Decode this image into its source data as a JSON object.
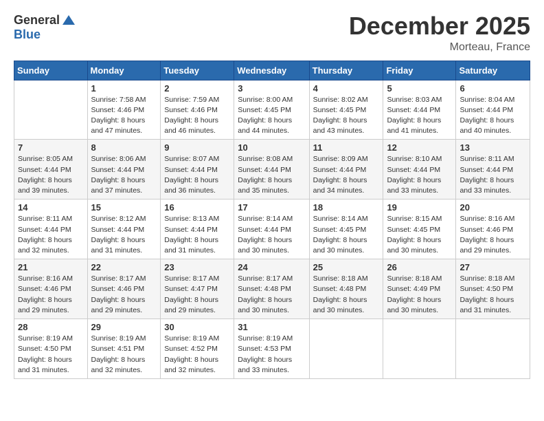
{
  "logo": {
    "general": "General",
    "blue": "Blue"
  },
  "title": {
    "month": "December 2025",
    "location": "Morteau, France"
  },
  "headers": [
    "Sunday",
    "Monday",
    "Tuesday",
    "Wednesday",
    "Thursday",
    "Friday",
    "Saturday"
  ],
  "weeks": [
    [
      {
        "day": "",
        "sunrise": "",
        "sunset": "",
        "daylight": ""
      },
      {
        "day": "1",
        "sunrise": "Sunrise: 7:58 AM",
        "sunset": "Sunset: 4:46 PM",
        "daylight": "Daylight: 8 hours and 47 minutes."
      },
      {
        "day": "2",
        "sunrise": "Sunrise: 7:59 AM",
        "sunset": "Sunset: 4:46 PM",
        "daylight": "Daylight: 8 hours and 46 minutes."
      },
      {
        "day": "3",
        "sunrise": "Sunrise: 8:00 AM",
        "sunset": "Sunset: 4:45 PM",
        "daylight": "Daylight: 8 hours and 44 minutes."
      },
      {
        "day": "4",
        "sunrise": "Sunrise: 8:02 AM",
        "sunset": "Sunset: 4:45 PM",
        "daylight": "Daylight: 8 hours and 43 minutes."
      },
      {
        "day": "5",
        "sunrise": "Sunrise: 8:03 AM",
        "sunset": "Sunset: 4:44 PM",
        "daylight": "Daylight: 8 hours and 41 minutes."
      },
      {
        "day": "6",
        "sunrise": "Sunrise: 8:04 AM",
        "sunset": "Sunset: 4:44 PM",
        "daylight": "Daylight: 8 hours and 40 minutes."
      }
    ],
    [
      {
        "day": "7",
        "sunrise": "Sunrise: 8:05 AM",
        "sunset": "Sunset: 4:44 PM",
        "daylight": "Daylight: 8 hours and 39 minutes."
      },
      {
        "day": "8",
        "sunrise": "Sunrise: 8:06 AM",
        "sunset": "Sunset: 4:44 PM",
        "daylight": "Daylight: 8 hours and 37 minutes."
      },
      {
        "day": "9",
        "sunrise": "Sunrise: 8:07 AM",
        "sunset": "Sunset: 4:44 PM",
        "daylight": "Daylight: 8 hours and 36 minutes."
      },
      {
        "day": "10",
        "sunrise": "Sunrise: 8:08 AM",
        "sunset": "Sunset: 4:44 PM",
        "daylight": "Daylight: 8 hours and 35 minutes."
      },
      {
        "day": "11",
        "sunrise": "Sunrise: 8:09 AM",
        "sunset": "Sunset: 4:44 PM",
        "daylight": "Daylight: 8 hours and 34 minutes."
      },
      {
        "day": "12",
        "sunrise": "Sunrise: 8:10 AM",
        "sunset": "Sunset: 4:44 PM",
        "daylight": "Daylight: 8 hours and 33 minutes."
      },
      {
        "day": "13",
        "sunrise": "Sunrise: 8:11 AM",
        "sunset": "Sunset: 4:44 PM",
        "daylight": "Daylight: 8 hours and 33 minutes."
      }
    ],
    [
      {
        "day": "14",
        "sunrise": "Sunrise: 8:11 AM",
        "sunset": "Sunset: 4:44 PM",
        "daylight": "Daylight: 8 hours and 32 minutes."
      },
      {
        "day": "15",
        "sunrise": "Sunrise: 8:12 AM",
        "sunset": "Sunset: 4:44 PM",
        "daylight": "Daylight: 8 hours and 31 minutes."
      },
      {
        "day": "16",
        "sunrise": "Sunrise: 8:13 AM",
        "sunset": "Sunset: 4:44 PM",
        "daylight": "Daylight: 8 hours and 31 minutes."
      },
      {
        "day": "17",
        "sunrise": "Sunrise: 8:14 AM",
        "sunset": "Sunset: 4:44 PM",
        "daylight": "Daylight: 8 hours and 30 minutes."
      },
      {
        "day": "18",
        "sunrise": "Sunrise: 8:14 AM",
        "sunset": "Sunset: 4:45 PM",
        "daylight": "Daylight: 8 hours and 30 minutes."
      },
      {
        "day": "19",
        "sunrise": "Sunrise: 8:15 AM",
        "sunset": "Sunset: 4:45 PM",
        "daylight": "Daylight: 8 hours and 30 minutes."
      },
      {
        "day": "20",
        "sunrise": "Sunrise: 8:16 AM",
        "sunset": "Sunset: 4:46 PM",
        "daylight": "Daylight: 8 hours and 29 minutes."
      }
    ],
    [
      {
        "day": "21",
        "sunrise": "Sunrise: 8:16 AM",
        "sunset": "Sunset: 4:46 PM",
        "daylight": "Daylight: 8 hours and 29 minutes."
      },
      {
        "day": "22",
        "sunrise": "Sunrise: 8:17 AM",
        "sunset": "Sunset: 4:46 PM",
        "daylight": "Daylight: 8 hours and 29 minutes."
      },
      {
        "day": "23",
        "sunrise": "Sunrise: 8:17 AM",
        "sunset": "Sunset: 4:47 PM",
        "daylight": "Daylight: 8 hours and 29 minutes."
      },
      {
        "day": "24",
        "sunrise": "Sunrise: 8:17 AM",
        "sunset": "Sunset: 4:48 PM",
        "daylight": "Daylight: 8 hours and 30 minutes."
      },
      {
        "day": "25",
        "sunrise": "Sunrise: 8:18 AM",
        "sunset": "Sunset: 4:48 PM",
        "daylight": "Daylight: 8 hours and 30 minutes."
      },
      {
        "day": "26",
        "sunrise": "Sunrise: 8:18 AM",
        "sunset": "Sunset: 4:49 PM",
        "daylight": "Daylight: 8 hours and 30 minutes."
      },
      {
        "day": "27",
        "sunrise": "Sunrise: 8:18 AM",
        "sunset": "Sunset: 4:50 PM",
        "daylight": "Daylight: 8 hours and 31 minutes."
      }
    ],
    [
      {
        "day": "28",
        "sunrise": "Sunrise: 8:19 AM",
        "sunset": "Sunset: 4:50 PM",
        "daylight": "Daylight: 8 hours and 31 minutes."
      },
      {
        "day": "29",
        "sunrise": "Sunrise: 8:19 AM",
        "sunset": "Sunset: 4:51 PM",
        "daylight": "Daylight: 8 hours and 32 minutes."
      },
      {
        "day": "30",
        "sunrise": "Sunrise: 8:19 AM",
        "sunset": "Sunset: 4:52 PM",
        "daylight": "Daylight: 8 hours and 32 minutes."
      },
      {
        "day": "31",
        "sunrise": "Sunrise: 8:19 AM",
        "sunset": "Sunset: 4:53 PM",
        "daylight": "Daylight: 8 hours and 33 minutes."
      },
      {
        "day": "",
        "sunrise": "",
        "sunset": "",
        "daylight": ""
      },
      {
        "day": "",
        "sunrise": "",
        "sunset": "",
        "daylight": ""
      },
      {
        "day": "",
        "sunrise": "",
        "sunset": "",
        "daylight": ""
      }
    ]
  ]
}
